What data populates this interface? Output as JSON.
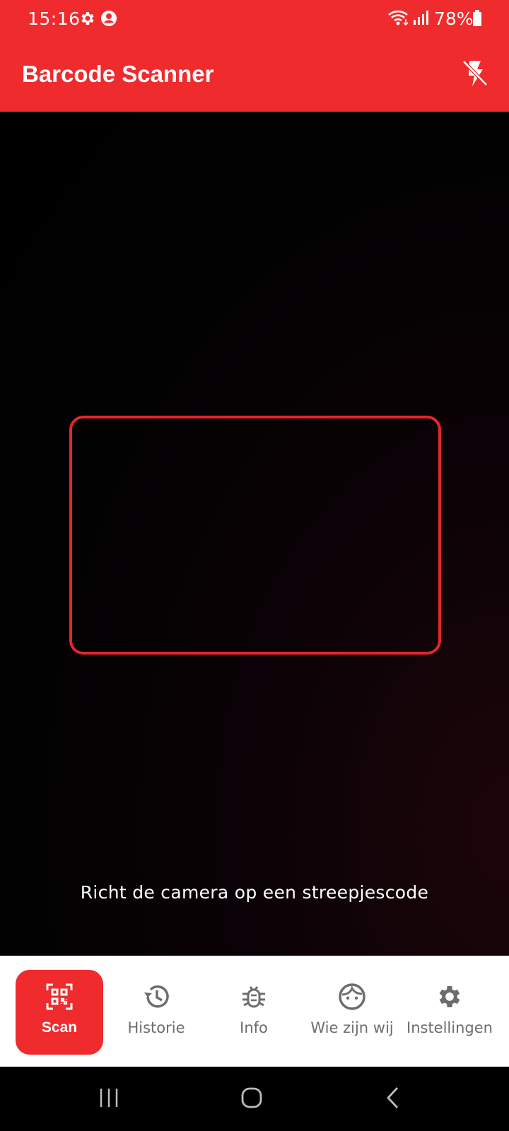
{
  "status_bar": {
    "time": "15:16",
    "battery_percent": "78%",
    "icons": [
      "gear-icon",
      "account-icon",
      "wifi-icon",
      "signal-icon",
      "battery-icon"
    ]
  },
  "app_bar": {
    "title": "Barcode Scanner",
    "flash_icon": "flash-off-icon",
    "background_color": "#ef2b2d"
  },
  "camera": {
    "hint": "Richt de camera op een streepjescode",
    "frame_color": "#e3262c"
  },
  "bottom_nav": {
    "items": [
      {
        "label": "Scan",
        "icon": "qr-scan-icon",
        "active": true
      },
      {
        "label": "Historie",
        "icon": "history-icon",
        "active": false
      },
      {
        "label": "Info",
        "icon": "bug-icon",
        "active": false
      },
      {
        "label": "Wie zijn wij",
        "icon": "face-icon",
        "active": false
      },
      {
        "label": "Instellingen",
        "icon": "gear-icon",
        "active": false
      }
    ],
    "active_color": "#ef2b2d",
    "inactive_color": "#6d6d6d"
  },
  "system_nav": {
    "buttons": [
      "recents-icon",
      "home-icon",
      "back-icon"
    ]
  }
}
